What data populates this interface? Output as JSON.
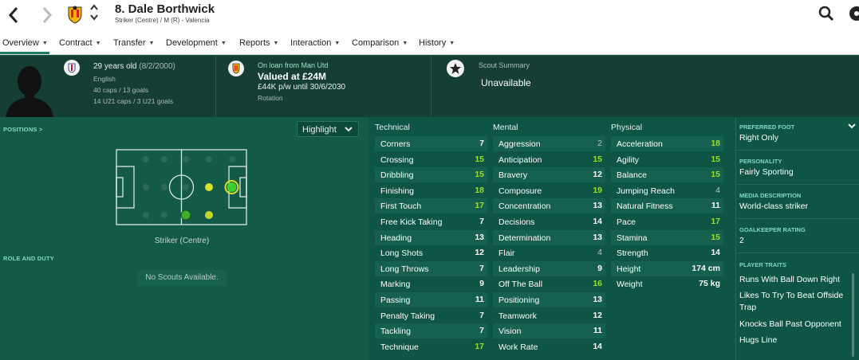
{
  "header": {
    "player_title": "8. Dale Borthwick",
    "player_subtitle": "Striker (Centre) / M (R) - Valencia",
    "back_icon": "chevron-left-icon",
    "forward_icon": "chevron-right-icon",
    "updown_icon": "up-down-chevron-icon"
  },
  "tabs": [
    {
      "label": "Overview"
    },
    {
      "label": "Contract"
    },
    {
      "label": "Transfer"
    },
    {
      "label": "Development"
    },
    {
      "label": "Reports"
    },
    {
      "label": "Interaction"
    },
    {
      "label": "Comparison"
    },
    {
      "label": "History"
    }
  ],
  "info": {
    "age": "29 years old",
    "dob": "(8/2/2000)",
    "nationality": "English",
    "caps": "40 caps / 13 goals",
    "u21_caps": "14 U21 caps / 3 U21 goals",
    "loan_from": "On loan from Man Utd",
    "value": "Valued at £24M",
    "wage": "£44K p/w until 30/6/2030",
    "status": "Rotation",
    "scout_title": "Scout Summary",
    "scout_value": "Unavailable"
  },
  "left": {
    "positions_heading": "POSITIONS >",
    "highlight_label": "Highlight",
    "position_label": "Striker (Centre)",
    "role_heading": "ROLE AND DUTY",
    "no_scouts": "No Scouts Available."
  },
  "attributes": {
    "technical_heading": "Technical",
    "mental_heading": "Mental",
    "physical_heading": "Physical",
    "technical": [
      {
        "name": "Corners",
        "value": "7"
      },
      {
        "name": "Crossing",
        "value": "15"
      },
      {
        "name": "Dribbling",
        "value": "15"
      },
      {
        "name": "Finishing",
        "value": "18"
      },
      {
        "name": "First Touch",
        "value": "17"
      },
      {
        "name": "Free Kick Taking",
        "value": "7"
      },
      {
        "name": "Heading",
        "value": "13"
      },
      {
        "name": "Long Shots",
        "value": "12"
      },
      {
        "name": "Long Throws",
        "value": "7"
      },
      {
        "name": "Marking",
        "value": "9"
      },
      {
        "name": "Passing",
        "value": "11"
      },
      {
        "name": "Penalty Taking",
        "value": "7"
      },
      {
        "name": "Tackling",
        "value": "7"
      },
      {
        "name": "Technique",
        "value": "17"
      }
    ],
    "mental": [
      {
        "name": "Aggression",
        "value": "2"
      },
      {
        "name": "Anticipation",
        "value": "15"
      },
      {
        "name": "Bravery",
        "value": "12"
      },
      {
        "name": "Composure",
        "value": "19"
      },
      {
        "name": "Concentration",
        "value": "13"
      },
      {
        "name": "Decisions",
        "value": "14"
      },
      {
        "name": "Determination",
        "value": "13"
      },
      {
        "name": "Flair",
        "value": "4"
      },
      {
        "name": "Leadership",
        "value": "9"
      },
      {
        "name": "Off The Ball",
        "value": "16"
      },
      {
        "name": "Positioning",
        "value": "13"
      },
      {
        "name": "Teamwork",
        "value": "12"
      },
      {
        "name": "Vision",
        "value": "11"
      },
      {
        "name": "Work Rate",
        "value": "14"
      }
    ],
    "physical": [
      {
        "name": "Acceleration",
        "value": "18"
      },
      {
        "name": "Agility",
        "value": "15"
      },
      {
        "name": "Balance",
        "value": "15"
      },
      {
        "name": "Jumping Reach",
        "value": "4"
      },
      {
        "name": "Natural Fitness",
        "value": "11"
      },
      {
        "name": "Pace",
        "value": "17"
      },
      {
        "name": "Stamina",
        "value": "15"
      },
      {
        "name": "Strength",
        "value": "14"
      },
      {
        "name": "Height",
        "value": "174 cm"
      },
      {
        "name": "Weight",
        "value": "75 kg"
      }
    ]
  },
  "right": {
    "foot_heading": "PREFERRED FOOT",
    "foot_value": "Right Only",
    "personality_heading": "PERSONALITY",
    "personality_value": "Fairly Sporting",
    "media_heading": "MEDIA DESCRIPTION",
    "media_value": "World-class striker",
    "gk_heading": "GOALKEEPER RATING",
    "gk_value": "2",
    "traits_heading": "PLAYER TRAITS",
    "traits": [
      "Runs With Ball Down Right",
      "Likes To Try To Beat Offside Trap",
      "Knocks Ball Past Opponent",
      "Hugs Line"
    ]
  },
  "colors": {
    "accent": "#7fd9c0",
    "high_attribute": "#9be02a",
    "background": "#0f5545"
  }
}
